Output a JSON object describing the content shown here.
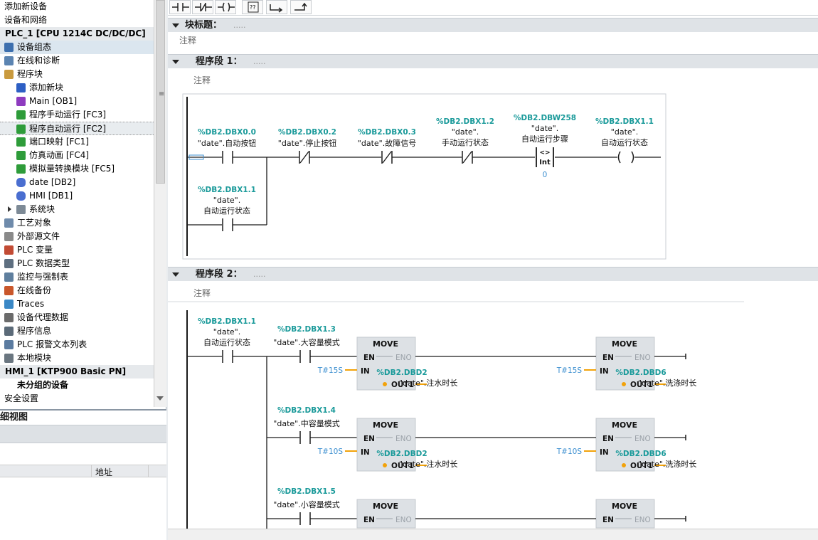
{
  "project_tree": {
    "items": [
      {
        "label": "添加新设备",
        "icon": "add-device-icon",
        "indent": 0
      },
      {
        "label": "设备和网络",
        "icon": "network-icon",
        "indent": 0
      },
      {
        "label": "PLC_1 [CPU 1214C DC/DC/DC]",
        "icon": "",
        "indent": 0,
        "header": true
      },
      {
        "label": "设备组态",
        "icon": "device-config-icon",
        "indent": 1,
        "selected": true
      },
      {
        "label": "在线和诊断",
        "icon": "online-diagnostics-icon",
        "indent": 1
      },
      {
        "label": "程序块",
        "icon": "folder-icon",
        "indent": 1
      },
      {
        "label": "添加新块",
        "icon": "add-block-icon",
        "indent": 2
      },
      {
        "label": "Main [OB1]",
        "icon": "ob-icon",
        "indent": 2
      },
      {
        "label": "程序手动运行 [FC3]",
        "icon": "fc-icon",
        "indent": 2
      },
      {
        "label": "程序自动运行 [FC2]",
        "icon": "fc-icon",
        "indent": 2,
        "selected2": true
      },
      {
        "label": "端口映射 [FC1]",
        "icon": "fc-icon",
        "indent": 2
      },
      {
        "label": "仿真动画 [FC4]",
        "icon": "fc-icon",
        "indent": 2
      },
      {
        "label": "模拟量转换模块 [FC5]",
        "icon": "fc-icon",
        "indent": 2
      },
      {
        "label": "date [DB2]",
        "icon": "db-icon",
        "indent": 2
      },
      {
        "label": "HMI [DB1]",
        "icon": "db-icon",
        "indent": 2
      },
      {
        "label": "系统块",
        "icon": "system-block-icon",
        "indent": 2,
        "expander": true
      },
      {
        "label": "工艺对象",
        "icon": "technology-icon",
        "indent": 1
      },
      {
        "label": "外部源文件",
        "icon": "source-file-icon",
        "indent": 1
      },
      {
        "label": "PLC 变量",
        "icon": "plc-tag-icon",
        "indent": 1
      },
      {
        "label": "PLC 数据类型",
        "icon": "data-type-icon",
        "indent": 1
      },
      {
        "label": "监控与强制表",
        "icon": "watch-table-icon",
        "indent": 1
      },
      {
        "label": "在线备份",
        "icon": "backup-icon",
        "indent": 1
      },
      {
        "label": "Traces",
        "icon": "traces-icon",
        "indent": 1
      },
      {
        "label": "设备代理数据",
        "icon": "proxy-data-icon",
        "indent": 1
      },
      {
        "label": "程序信息",
        "icon": "program-info-icon",
        "indent": 1
      },
      {
        "label": "PLC 报警文本列表",
        "icon": "alarm-text-icon",
        "indent": 1
      },
      {
        "label": "本地模块",
        "icon": "local-module-icon",
        "indent": 1
      },
      {
        "label": "HMI_1 [KTP900 Basic PN]",
        "icon": "",
        "indent": 0,
        "header": true
      },
      {
        "label": "未分组的设备",
        "icon": "",
        "indent": 0,
        "bold": true
      },
      {
        "label": "安全设置",
        "icon": "security-icon",
        "indent": 0
      }
    ]
  },
  "detail_view": {
    "title": "细视图",
    "column_address": "地址"
  },
  "editor": {
    "block_title": {
      "label": "块标题：",
      "dots": "....."
    },
    "block_comment": "注释",
    "network1": {
      "label": "程序段 1：",
      "dots": ".....",
      "comment": "注释"
    },
    "network2": {
      "label": "程序段 2：",
      "dots": ".....",
      "comment": "注释"
    }
  },
  "ladder1": {
    "contacts": [
      {
        "addr": "%DB2.DBX0.0",
        "name": "\"date\".自动按钮",
        "type": "NO"
      },
      {
        "addr": "%DB2.DBX0.2",
        "name": "\"date\".停止按钮",
        "type": "NC"
      },
      {
        "addr": "%DB2.DBX0.3",
        "name": "\"date\".故障信号",
        "type": "NC"
      },
      {
        "addr": "%DB2.DBX1.2",
        "name1": "\"date\".",
        "name2": "手动运行状态",
        "type": "NC"
      }
    ],
    "compare": {
      "addr": "%DB2.DBW258",
      "name1": "\"date\".",
      "name2": "自动运行步骤",
      "op": "<>",
      "dtype": "Int",
      "value": "0"
    },
    "coil": {
      "addr": "%DB2.DBX1.1",
      "name1": "\"date\".",
      "name2": "自动运行状态",
      "symbol": "( )"
    },
    "branch": {
      "addr": "%DB2.DBX1.1",
      "name1": "\"date\".",
      "name2": "自动运行状态"
    }
  },
  "ladder2": {
    "first": {
      "addr": "%DB2.DBX1.1",
      "name1": "\"date\".",
      "name2": "自动运行状态"
    },
    "rows": [
      {
        "addr": "%DB2.DBX1.3",
        "name": "\"date\".大容量模式",
        "in1": "T#15S",
        "out1_addr": "%DB2.DBD2",
        "out1_name": "\"date\".注水时长",
        "in2": "T#15S",
        "out2_addr": "%DB2.DBD6",
        "out2_name": "\"date\".洗涤时长"
      },
      {
        "addr": "%DB2.DBX1.4",
        "name": "\"date\".中容量模式",
        "in1": "T#10S",
        "out1_addr": "%DB2.DBD2",
        "out1_name": "\"date\".注水时长",
        "in2": "T#10S",
        "out2_addr": "%DB2.DBD6",
        "out2_name": "\"date\".洗涤时长"
      },
      {
        "addr": "%DB2.DBX1.5",
        "name": "\"date\".小容量模式",
        "in1": "",
        "out1_addr": "",
        "out1_name": "",
        "in2": "",
        "out2_addr": "",
        "out2_name": ""
      }
    ],
    "box": {
      "title": "MOVE",
      "en": "EN",
      "eno": "ENO",
      "in": "IN",
      "out": "OUT1"
    }
  },
  "colors": {
    "teal": "#1a9a9a",
    "ladder": "#1a1a1a",
    "box": "#dde1e5",
    "orange": "#f2a20a",
    "accent": "#3c8fd0"
  }
}
